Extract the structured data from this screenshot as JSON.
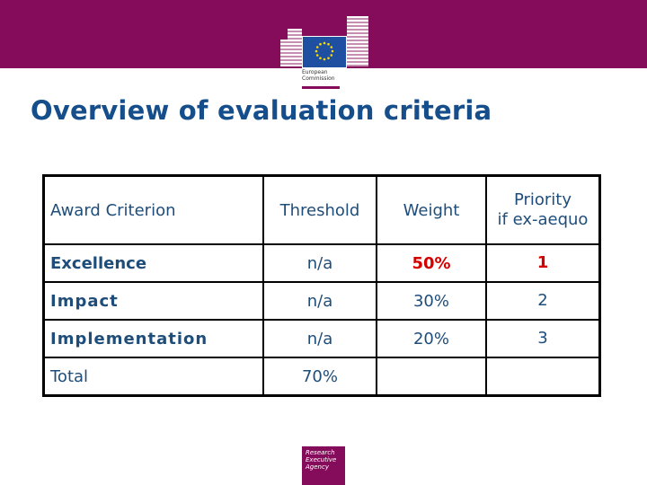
{
  "header": {
    "logo_text_line1": "European",
    "logo_text_line2": "Commission",
    "brand_color": "#850c5a"
  },
  "title": "Overview of evaluation criteria",
  "table": {
    "headers": [
      "Award Criterion",
      "Threshold",
      "Weight",
      "Priority",
      "if ex-aequo"
    ],
    "rows": [
      {
        "criterion": "Excellence",
        "threshold": "n/a",
        "weight": "50%",
        "priority": "1"
      },
      {
        "criterion": "Impact",
        "threshold": "n/a",
        "weight": "30%",
        "priority": "2"
      },
      {
        "criterion": "Implementation",
        "threshold": "n/a",
        "weight": "20%",
        "priority": "3"
      },
      {
        "criterion": "Total",
        "threshold": "70%",
        "weight": "",
        "priority": ""
      }
    ]
  },
  "footer": {
    "agency_line1": "Research",
    "agency_line2": "Executive",
    "agency_line3": "Agency"
  }
}
